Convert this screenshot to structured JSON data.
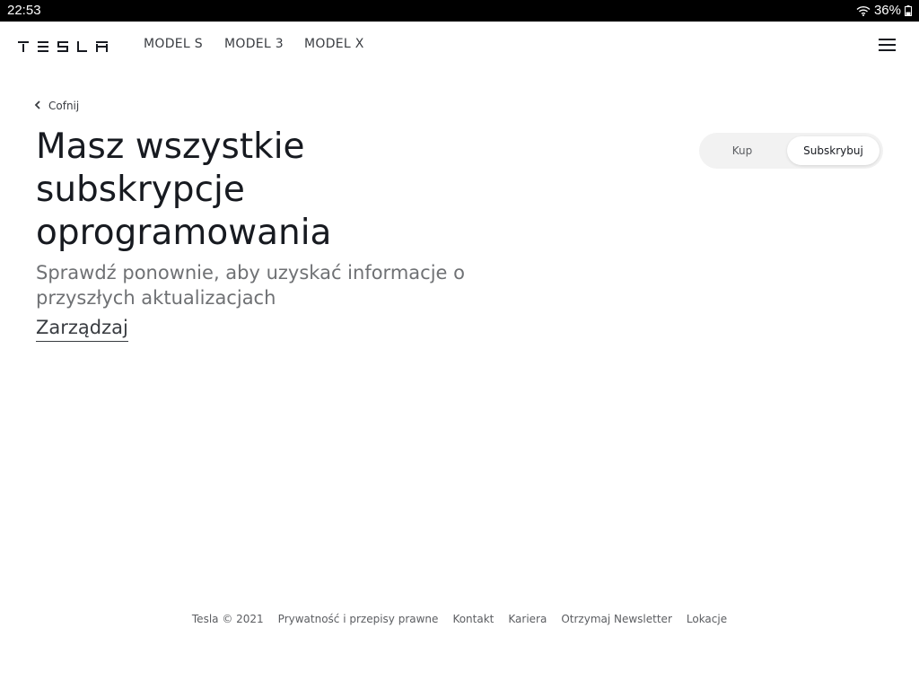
{
  "status_bar": {
    "time": "22:53",
    "battery": "36%",
    "icons": [
      "wifi-icon",
      "battery-icon"
    ]
  },
  "nav": {
    "logo_text": "TESLA",
    "links": [
      "MODEL S",
      "MODEL 3",
      "MODEL X"
    ],
    "menu_icon": "hamburger-menu-icon"
  },
  "back": {
    "label": "Cofnij",
    "icon": "chevron-left-icon"
  },
  "main": {
    "title": "Masz wszystkie subskrypcje oprogramowania",
    "subtitle": "Sprawdź ponownie, aby uzyskać informacje o przyszłych aktualizacjach",
    "manage_link": "Zarządzaj"
  },
  "toggle": {
    "options": [
      "Kup",
      "Subskrybuj"
    ],
    "selected": "Subskrybuj"
  },
  "footer": {
    "copyright": "Tesla © 2021",
    "links": [
      "Prywatność i przepisy prawne",
      "Kontakt",
      "Kariera",
      "Otrzymaj Newsletter",
      "Lokacje"
    ]
  },
  "colors": {
    "text_primary": "#171a20",
    "text_secondary": "#6f7174",
    "toggle_bg": "#f2f2f2",
    "status_bar_bg": "#000000"
  }
}
